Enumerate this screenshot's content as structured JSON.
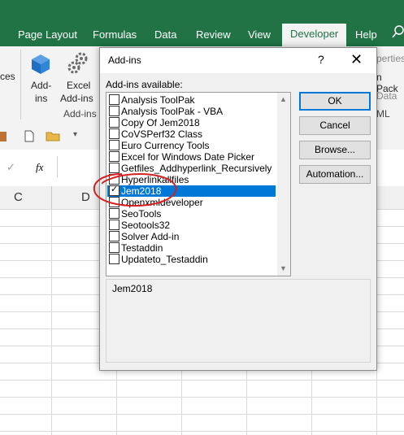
{
  "ribbon": {
    "tabs": [
      "Page Layout",
      "Formulas",
      "Data",
      "Review",
      "View",
      "Developer",
      "Help"
    ],
    "active_tab": "Developer",
    "left_fragment": "ces",
    "addins_label_1": "Add-",
    "addins_label_2": "ins",
    "excel_addins_label_1": "Excel",
    "excel_addins_label_2": "Add-ins",
    "group_label": "Add-ins",
    "right_fragments": [
      "perties",
      "n Pack",
      "Data",
      "ML"
    ]
  },
  "formula_bar": {
    "fx": "fx"
  },
  "columns": [
    "C",
    "D"
  ],
  "dialog": {
    "title": "Add-ins",
    "help": "?",
    "close": "✕",
    "list_label": "Add-ins available:",
    "items": [
      {
        "label": "Analysis ToolPak",
        "checked": false
      },
      {
        "label": "Analysis ToolPak - VBA",
        "checked": false
      },
      {
        "label": "Copy Of Jem2018",
        "checked": false
      },
      {
        "label": "CoVSPerf32 Class",
        "checked": false
      },
      {
        "label": "Euro Currency Tools",
        "checked": false
      },
      {
        "label": "Excel for Windows Date Picker",
        "checked": false
      },
      {
        "label": "Getfiles_Addhyperlink_Recursively",
        "checked": false
      },
      {
        "label": "Hyperlinkallfiles",
        "checked": false
      },
      {
        "label": "Jem2018",
        "checked": true,
        "selected": true
      },
      {
        "label": "Openxmldeveloper",
        "checked": false
      },
      {
        "label": "SeoTools",
        "checked": false
      },
      {
        "label": "Seotools32",
        "checked": false
      },
      {
        "label": "Solver Add-in",
        "checked": false
      },
      {
        "label": "Testaddin",
        "checked": false
      },
      {
        "label": "Updateto_Testaddin",
        "checked": false
      }
    ],
    "buttons": {
      "ok": "OK",
      "cancel": "Cancel",
      "browse": "Browse...",
      "automation": "Automation..."
    },
    "description": "Jem2018"
  },
  "colors": {
    "excel_green": "#217346",
    "selection_blue": "#0078d7",
    "annotation_red": "#d42020"
  }
}
